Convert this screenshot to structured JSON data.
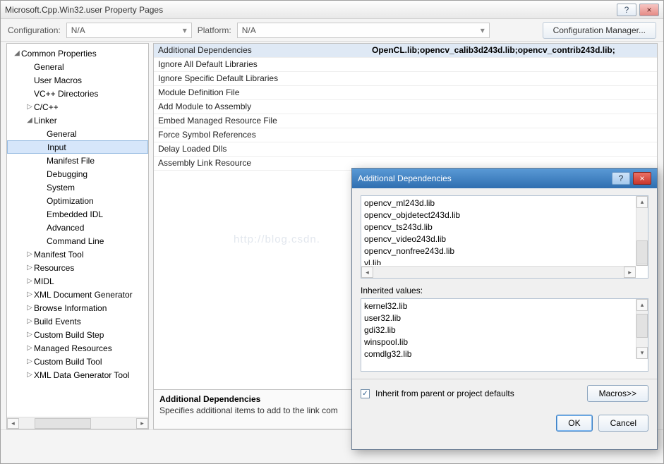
{
  "window": {
    "title": "Microsoft.Cpp.Win32.user Property Pages",
    "help": "?",
    "close": "×"
  },
  "config": {
    "label_configuration": "Configuration:",
    "value_configuration": "N/A",
    "label_platform": "Platform:",
    "value_platform": "N/A",
    "manager": "Configuration Manager..."
  },
  "tree": {
    "items": [
      {
        "tw": "◢",
        "ind": 0,
        "label": "Common Properties"
      },
      {
        "tw": "",
        "ind": 1,
        "label": "General"
      },
      {
        "tw": "",
        "ind": 1,
        "label": "User Macros"
      },
      {
        "tw": "",
        "ind": 1,
        "label": "VC++ Directories"
      },
      {
        "tw": "▷",
        "ind": 1,
        "label": "C/C++"
      },
      {
        "tw": "◢",
        "ind": 1,
        "label": "Linker"
      },
      {
        "tw": "",
        "ind": 2,
        "label": "General"
      },
      {
        "tw": "",
        "ind": 2,
        "label": "Input",
        "selected": true
      },
      {
        "tw": "",
        "ind": 2,
        "label": "Manifest File"
      },
      {
        "tw": "",
        "ind": 2,
        "label": "Debugging"
      },
      {
        "tw": "",
        "ind": 2,
        "label": "System"
      },
      {
        "tw": "",
        "ind": 2,
        "label": "Optimization"
      },
      {
        "tw": "",
        "ind": 2,
        "label": "Embedded IDL"
      },
      {
        "tw": "",
        "ind": 2,
        "label": "Advanced"
      },
      {
        "tw": "",
        "ind": 2,
        "label": "Command Line"
      },
      {
        "tw": "▷",
        "ind": 1,
        "label": "Manifest Tool"
      },
      {
        "tw": "▷",
        "ind": 1,
        "label": "Resources"
      },
      {
        "tw": "▷",
        "ind": 1,
        "label": "MIDL"
      },
      {
        "tw": "▷",
        "ind": 1,
        "label": "XML Document Generator"
      },
      {
        "tw": "▷",
        "ind": 1,
        "label": "Browse Information"
      },
      {
        "tw": "▷",
        "ind": 1,
        "label": "Build Events"
      },
      {
        "tw": "▷",
        "ind": 1,
        "label": "Custom Build Step"
      },
      {
        "tw": "▷",
        "ind": 1,
        "label": "Managed Resources"
      },
      {
        "tw": "▷",
        "ind": 1,
        "label": "Custom Build Tool"
      },
      {
        "tw": "▷",
        "ind": 1,
        "label": "XML Data Generator Tool"
      }
    ]
  },
  "grid": {
    "rows": [
      {
        "k": "Additional Dependencies",
        "v": "OpenCL.lib;opencv_calib3d243d.lib;opencv_contrib243d.lib;",
        "sel": true
      },
      {
        "k": "Ignore All Default Libraries",
        "v": ""
      },
      {
        "k": "Ignore Specific Default Libraries",
        "v": ""
      },
      {
        "k": "Module Definition File",
        "v": ""
      },
      {
        "k": "Add Module to Assembly",
        "v": ""
      },
      {
        "k": "Embed Managed Resource File",
        "v": ""
      },
      {
        "k": "Force Symbol References",
        "v": ""
      },
      {
        "k": "Delay Loaded Dlls",
        "v": ""
      },
      {
        "k": "Assembly Link Resource",
        "v": ""
      }
    ]
  },
  "desc": {
    "title": "Additional Dependencies",
    "text": "Specifies additional items to add to the link com"
  },
  "dialog": {
    "title": "Additional Dependencies",
    "help": "?",
    "close": "×",
    "edit_lines": "opencv_ml243d.lib\nopencv_objdetect243d.lib\nopencv_ts243d.lib\nopencv_video243d.lib\nopencv_nonfree243d.lib\nvl.lib",
    "inherited_label": "Inherited values:",
    "inherited_lines": [
      "kernel32.lib",
      "user32.lib",
      "gdi32.lib",
      "winspool.lib",
      "comdlg32.lib"
    ],
    "inherit_check": "Inherit from parent or project defaults",
    "macros": "Macros>>",
    "ok": "OK",
    "cancel": "Cancel"
  },
  "watermark": "http://blog.csdn."
}
